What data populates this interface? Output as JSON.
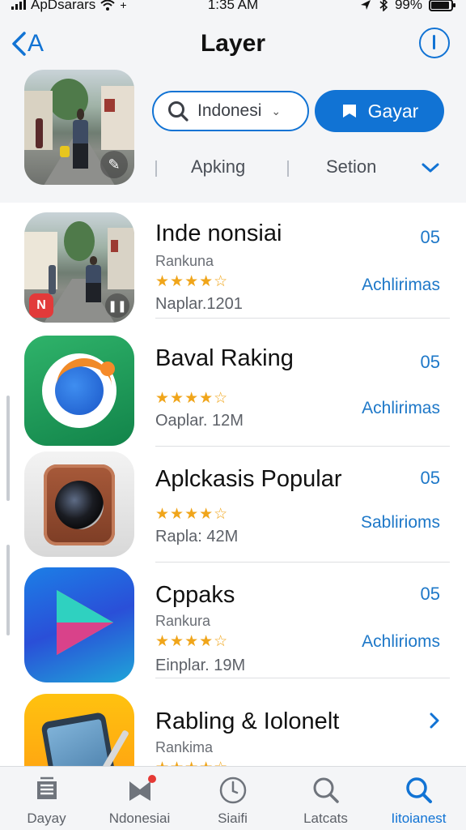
{
  "status": {
    "carrier": "ApDsarars",
    "time": "1:35 AM",
    "battery": "99%"
  },
  "header": {
    "back_label": "A",
    "title": "Layer",
    "search_value": "Indonesi",
    "primary_button": "Gayar",
    "segments": [
      "Apking",
      "Setion"
    ]
  },
  "apps": [
    {
      "name": "Inde nonsiai",
      "subtitle": "Rankuna",
      "rating": 4,
      "size": "Naplar.1201",
      "number": "05",
      "action": "Achlirimas"
    },
    {
      "name": "Baval Raking",
      "subtitle": "",
      "rating": 4,
      "size": "Oaplar. 12M",
      "number": "05",
      "action": "Achlirimas"
    },
    {
      "name": "Aplckasis Popular",
      "subtitle": "",
      "rating": 4,
      "size": "Rapla: 42M",
      "number": "05",
      "action": "Sablirioms"
    },
    {
      "name": "Cppaks",
      "subtitle": "Rankura",
      "rating": 4,
      "size": "Einplar. 19M",
      "number": "05",
      "action": "Achlirioms"
    },
    {
      "name": "Rabling & Iolonelt",
      "subtitle": "Rankima",
      "rating": 4,
      "size": "",
      "number": "",
      "action": ""
    }
  ],
  "tabs": [
    {
      "label": "Dayay",
      "icon": "news-icon",
      "active": false
    },
    {
      "label": "Ndonesiai",
      "icon": "bookmark-icon",
      "active": false
    },
    {
      "label": "Siaifi",
      "icon": "compass-icon",
      "active": false
    },
    {
      "label": "Latcats",
      "icon": "search-icon",
      "active": false
    },
    {
      "label": "Iitoianest",
      "icon": "search-icon",
      "active": true
    }
  ],
  "colors": {
    "accent": "#1173d4",
    "star": "#f0a51a",
    "header_bg": "#f4f5f7"
  }
}
